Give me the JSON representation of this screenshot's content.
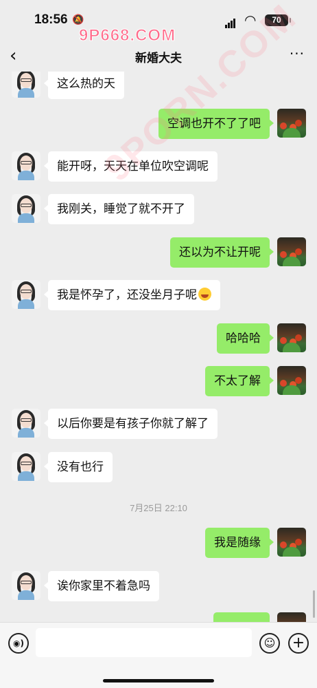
{
  "status_bar": {
    "time": "18:56",
    "battery": "70"
  },
  "watermarks": {
    "top": "9P668.COM",
    "diagonal": "9PORN.COM"
  },
  "nav": {
    "back_icon": "chevron-left-icon",
    "title": "新婚大夫",
    "more_icon": "more-dots-icon"
  },
  "messages": [
    {
      "from": "her",
      "text": "这么热的天"
    },
    {
      "from": "me",
      "text": "空调也开不了了吧"
    },
    {
      "from": "her",
      "text": "能开呀，天天在单位吹空调呢"
    },
    {
      "from": "her",
      "text": "我刚关，睡觉了就不开了"
    },
    {
      "from": "me",
      "text": "还以为不让开呢"
    },
    {
      "from": "her",
      "text": "我是怀孕了，还没坐月子呢",
      "emoji": "tears-of-joy-emoji"
    },
    {
      "from": "me",
      "text": "哈哈哈"
    },
    {
      "from": "me",
      "text": "不太了解"
    },
    {
      "from": "her",
      "text": "以后你要是有孩子你就了解了"
    },
    {
      "from": "her",
      "text": "没有也行"
    },
    {
      "from": "me",
      "text": "我是随缘"
    },
    {
      "from": "her",
      "text": "诶你家里不着急吗"
    },
    {
      "from": "me",
      "text": ""
    }
  ],
  "timestamp": "7月25日 22:10",
  "input_bar": {
    "voice_icon": "voice-icon",
    "text_value": "",
    "emoji_icon": "emoji-icon",
    "plus_icon": "plus-icon"
  },
  "colors": {
    "me_bubble": "#95ec69",
    "her_bubble": "#ffffff",
    "background": "#ededed"
  }
}
